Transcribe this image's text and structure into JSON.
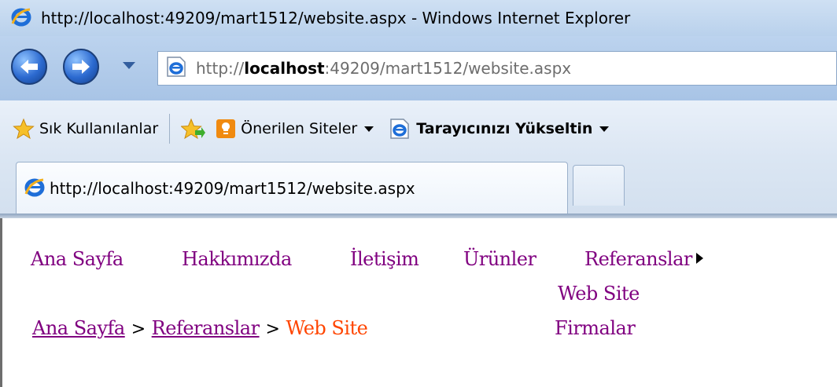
{
  "window": {
    "title": "http://localhost:49209/mart1512/website.aspx - Windows Internet Explorer"
  },
  "address_bar": {
    "url_prefix": "http://",
    "url_host": "localhost",
    "url_rest": ":49209/mart1512/website.aspx",
    "icon": "ie-page-icon"
  },
  "favorites_bar": {
    "favorites_label": "Sık Kullanılanlar",
    "suggested_sites_label": "Önerilen Siteler",
    "upgrade_label": "Tarayıcınızı Yükseltin"
  },
  "tabs": [
    {
      "label": "http://localhost:49209/mart1512/website.aspx",
      "active": true
    }
  ],
  "page": {
    "menu": [
      {
        "label": "Ana Sayfa"
      },
      {
        "label": "Hakkımızda"
      },
      {
        "label": "İletişim"
      },
      {
        "label": "Ürünler"
      },
      {
        "label": "Referanslar"
      }
    ],
    "submenu": [
      {
        "label": "Web Site"
      },
      {
        "label": "Firmalar"
      }
    ],
    "breadcrumb": {
      "home": "Ana Sayfa",
      "separator": ">",
      "section": "Referanslar",
      "current": "Web Site"
    }
  },
  "colors": {
    "link_visited": "#800080",
    "breadcrumb_current": "#ff4500",
    "chrome_blue": "#bcd3ee"
  }
}
